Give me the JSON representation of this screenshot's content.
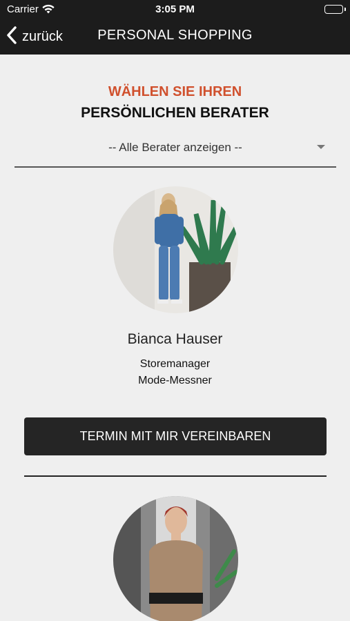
{
  "status_bar": {
    "carrier": "Carrier",
    "time": "3:05 PM"
  },
  "nav": {
    "back_label": "zurück",
    "title": "PERSONAL SHOPPING"
  },
  "heading": {
    "accent": "WÄHLEN SIE IHREN",
    "main": "PERSÖNLICHEN BERATER"
  },
  "filter": {
    "selected": "-- Alle Berater anzeigen --"
  },
  "advisors": [
    {
      "name": "Bianca Hauser",
      "role": "Storemanager",
      "company": "Mode-Messner",
      "button_label": "TERMIN MIT MIR VEREINBAREN"
    }
  ],
  "colors": {
    "accent": "#d0502d",
    "bar": "#1c1c1c",
    "background": "#efefef",
    "button": "#252525"
  }
}
